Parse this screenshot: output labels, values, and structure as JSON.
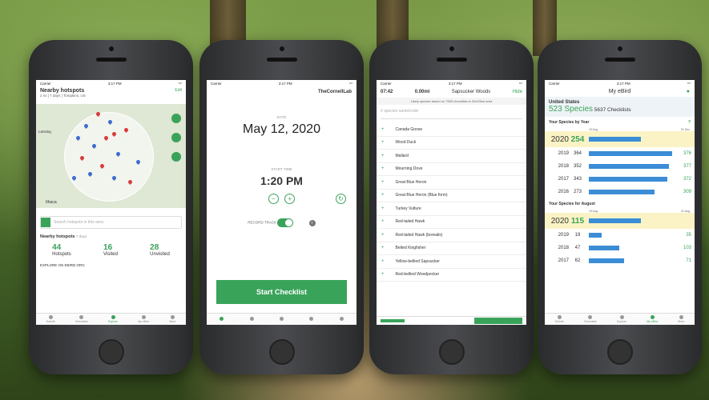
{
  "phone1": {
    "status": {
      "carrier": "Carrier",
      "time": "3:17 PM"
    },
    "header": {
      "title": "Nearby hotspots",
      "subtitle": "2 mi | 7 days | Tompkins, US",
      "edit": "Edit"
    },
    "map": {
      "label_city": "Lansing",
      "label_town": "Ithaca"
    },
    "search_placeholder": "Search hotspots in this area",
    "section_title": "Nearby hotspots",
    "section_sub": "7 days",
    "stats": [
      {
        "value": "44",
        "label": "Hotspots"
      },
      {
        "value": "16",
        "label": "Visited"
      },
      {
        "value": "28",
        "label": "Unvisited"
      }
    ],
    "explore_link": "EXPLORE ON EBIRD.ORG",
    "tabs": [
      "Submit",
      "Checklists",
      "Explore",
      "My eBird",
      "More"
    ]
  },
  "phone2": {
    "status": {
      "carrier": "Carrier",
      "time": "3:17 PM"
    },
    "logo": "TheCornellLab",
    "date_label": "DATE",
    "date_value": "May 12, 2020",
    "start_label": "START TIME",
    "start_value": "1:20 PM",
    "minus": "−",
    "plus": "+",
    "refresh": "↻",
    "record_label": "RECORD TRACK",
    "info": "i",
    "start_button": "Start Checklist"
  },
  "phone3": {
    "status": {
      "carrier": "Carrier",
      "time": "3:17 PM"
    },
    "timer": "07:42",
    "distance": "0.00mi",
    "location": "Sapsucker Woods",
    "hide": "Hide",
    "likely_note": "Likely species based on 7505 checklists in 20x20km area",
    "search_placeholder": "# species name/code",
    "species": [
      "Canada Goose",
      "Wood Duck",
      "Mallard",
      "Mourning Dove",
      "Great Blue Heron",
      "Great Blue Heron (Blue form)",
      "Turkey Vulture",
      "Red-tailed Hawk",
      "Red-tailed Hawk (borealis)",
      "Belted Kingfisher",
      "Yellow-bellied Sapsucker",
      "Red-bellied Woodpecker"
    ]
  },
  "phone4": {
    "status": {
      "carrier": "Carrier",
      "time": "3:17 PM"
    },
    "title": "My eBird",
    "region": "United States",
    "species_count": "523 Species",
    "checklists": "5637 Checklists",
    "year_section": "Your Species by Year",
    "year_date_left": "19 Aug",
    "year_date_right": "31 Dec",
    "years": [
      {
        "year": "2020",
        "count": "254",
        "total": "",
        "fraction": 0.6
      },
      {
        "year": "2019",
        "count": "364",
        "total": "376",
        "fraction": 0.95
      },
      {
        "year": "2018",
        "count": "352",
        "total": "377",
        "fraction": 0.92
      },
      {
        "year": "2017",
        "count": "343",
        "total": "372",
        "fraction": 0.9
      },
      {
        "year": "2016",
        "count": "273",
        "total": "309",
        "fraction": 0.75
      }
    ],
    "month_section": "Your Species for August",
    "month_date_left": "19 Aug",
    "month_date_right": "31 Aug",
    "months": [
      {
        "year": "2020",
        "count": "115",
        "total": "",
        "fraction": 0.6
      },
      {
        "year": "2019",
        "count": "19",
        "total": "35",
        "fraction": 0.15
      },
      {
        "year": "2018",
        "count": "47",
        "total": "103",
        "fraction": 0.35
      },
      {
        "year": "2017",
        "count": "62",
        "total": "71",
        "fraction": 0.4
      }
    ],
    "tabs": [
      "Submit",
      "Checklists",
      "Explore",
      "My eBird",
      "More"
    ]
  }
}
